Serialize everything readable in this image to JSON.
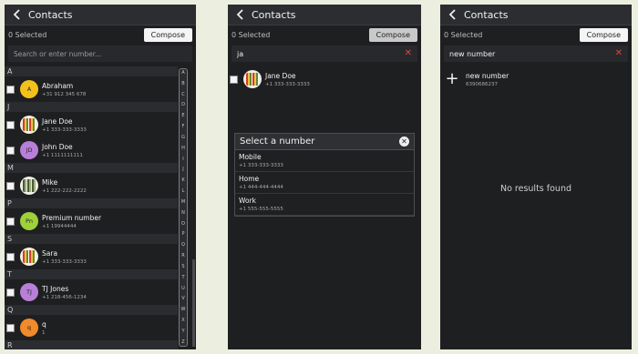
{
  "app": {
    "title": "Contacts",
    "compose_label": "Compose",
    "selected_text": "0 Selected"
  },
  "screen1": {
    "search_placeholder": "Search or enter number...",
    "alphabet": [
      "A",
      "B",
      "C",
      "D",
      "E",
      "F",
      "G",
      "H",
      "I",
      "J",
      "K",
      "L",
      "M",
      "N",
      "O",
      "P",
      "Q",
      "R",
      "S",
      "T",
      "U",
      "V",
      "W",
      "X",
      "Y",
      "Z"
    ],
    "sections": [
      {
        "letter": "A",
        "contacts": [
          {
            "name": "Abraham",
            "phone": "+31 912 345 678",
            "avatar": "A",
            "avatar_color": "#f2c11c"
          }
        ]
      },
      {
        "letter": "J",
        "contacts": [
          {
            "name": "Jane Doe",
            "phone": "+1 333-333-3333",
            "avatar": "picture"
          },
          {
            "name": "John Doe",
            "phone": "+1 1111111111",
            "avatar": "JD",
            "avatar_color": "#b97fd8"
          }
        ]
      },
      {
        "letter": "M",
        "contacts": [
          {
            "name": "Mike",
            "phone": "+1 222-222-2222",
            "avatar": "picture2"
          }
        ]
      },
      {
        "letter": "P",
        "contacts": [
          {
            "name": "Premium number",
            "phone": "+1 19944444",
            "avatar": "Pn",
            "avatar_color": "#9ed13a"
          }
        ]
      },
      {
        "letter": "S",
        "contacts": [
          {
            "name": "Sara",
            "phone": "+1 333-333-3333",
            "avatar": "picture"
          }
        ]
      },
      {
        "letter": "T",
        "contacts": [
          {
            "name": "TJ Jones",
            "phone": "+1 218-456-1234",
            "avatar": "TJ",
            "avatar_color": "#b97fd8"
          }
        ]
      },
      {
        "letter": "Q",
        "contacts": [
          {
            "name": "q",
            "phone": "1",
            "avatar": "q",
            "avatar_color": "#f08a2a"
          }
        ]
      },
      {
        "letter": "R",
        "contacts": []
      }
    ]
  },
  "screen2": {
    "search_value": "ja",
    "result": {
      "name": "Jane Doe",
      "phone": "+1 333-333-3333"
    },
    "modal": {
      "title": "Select a number",
      "options": [
        {
          "label": "Mobile",
          "number": "+1 333-333-3333"
        },
        {
          "label": "Home",
          "number": "+1 444-444-4444"
        },
        {
          "label": "Work",
          "number": "+1 555-555-5555"
        }
      ]
    }
  },
  "screen3": {
    "search_value": "new number",
    "new_item": {
      "label": "new number",
      "number": "6390686237"
    },
    "no_results": "No results found"
  }
}
